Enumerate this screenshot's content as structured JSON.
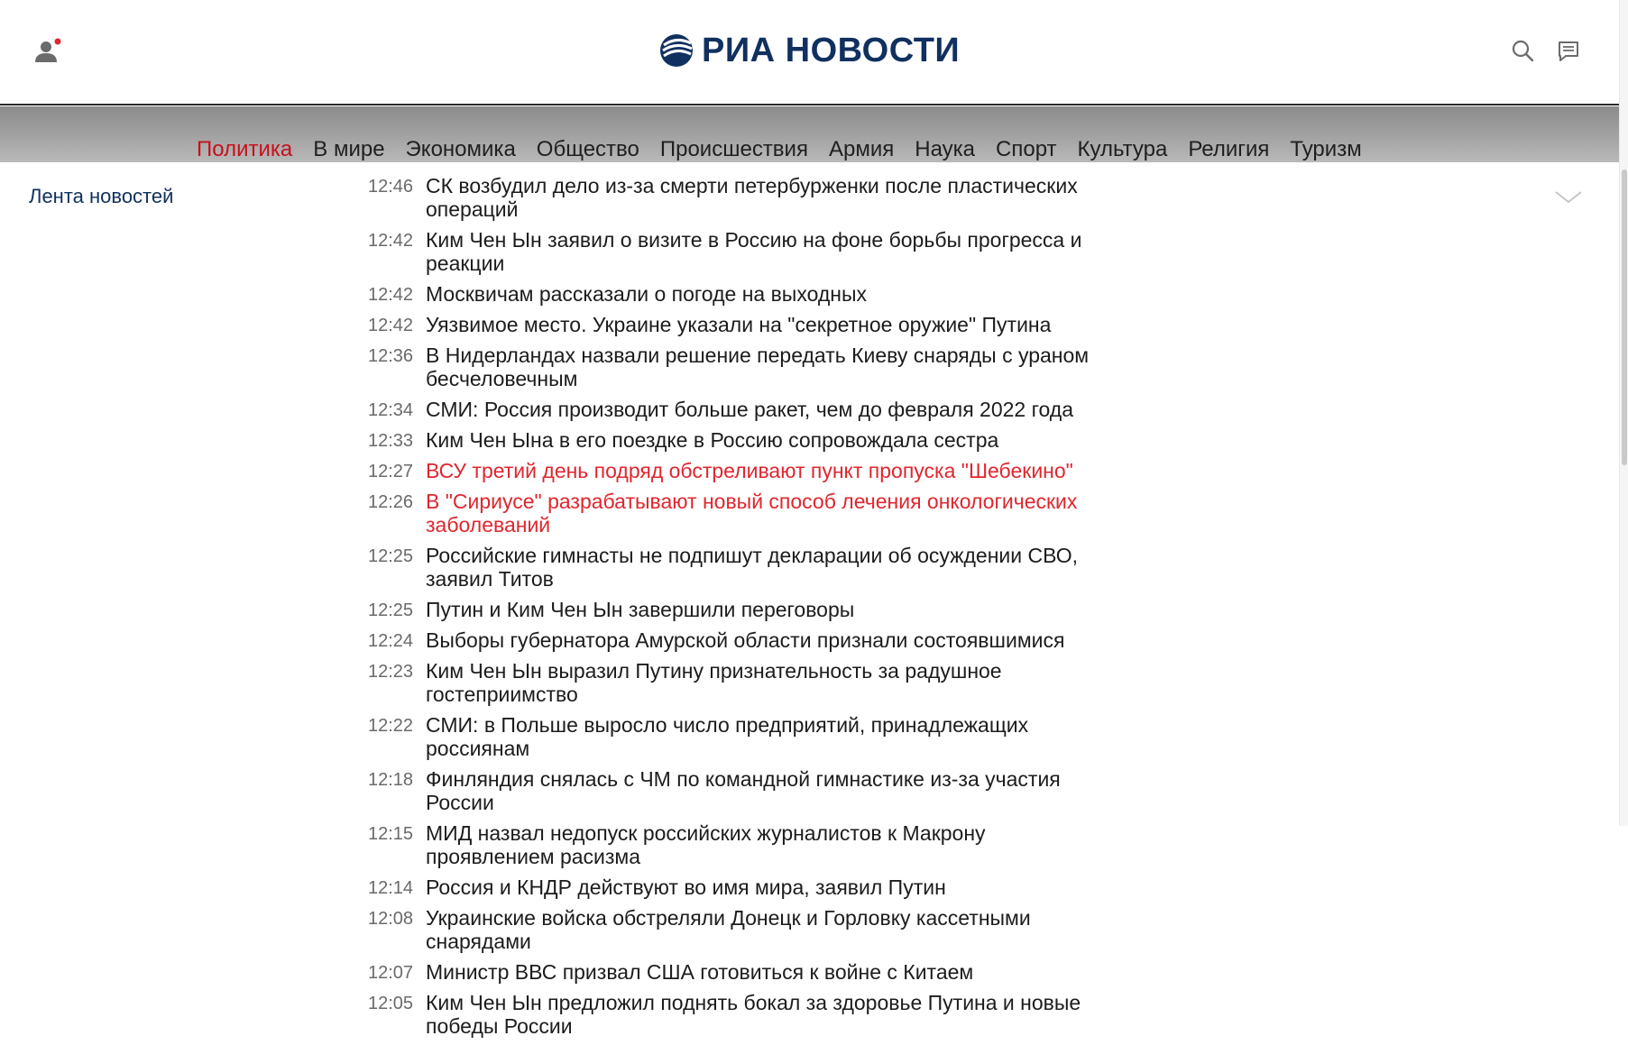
{
  "header": {
    "logo_text": "РИА НОВОСТИ",
    "icons": {
      "user": "user-icon",
      "search": "search-icon",
      "chat": "chat-icon"
    },
    "brand_color": "#10305f",
    "notification_dot_color": "#e0262e"
  },
  "nav": {
    "items": [
      {
        "label": "Политика",
        "active": true
      },
      {
        "label": "В мире",
        "active": false
      },
      {
        "label": "Экономика",
        "active": false
      },
      {
        "label": "Общество",
        "active": false
      },
      {
        "label": "Происшествия",
        "active": false
      },
      {
        "label": "Армия",
        "active": false
      },
      {
        "label": "Наука",
        "active": false
      },
      {
        "label": "Спорт",
        "active": false
      },
      {
        "label": "Культура",
        "active": false
      },
      {
        "label": "Религия",
        "active": false
      },
      {
        "label": "Туризм",
        "active": false
      }
    ],
    "active_color": "#c8101a"
  },
  "feed": {
    "title": "Лента новостей",
    "expand_icon": "chevron-down-icon",
    "highlight_color": "#e0262e",
    "items": [
      {
        "time": "12:46",
        "text": "СК возбудил дело из-за смерти петербурженки после пластических операций",
        "highlight": false
      },
      {
        "time": "12:42",
        "text": "Ким Чен Ын заявил о визите в Россию на фоне борьбы прогресса и реакции",
        "highlight": false
      },
      {
        "time": "12:42",
        "text": "Москвичам рассказали о погоде на выходных",
        "highlight": false
      },
      {
        "time": "12:42",
        "text": "Уязвимое место. Украине указали на \"секретное оружие\" Путина",
        "highlight": false
      },
      {
        "time": "12:36",
        "text": "В Нидерландах назвали решение передать Киеву снаряды с ураном бесчеловечным",
        "highlight": false
      },
      {
        "time": "12:34",
        "text": "СМИ: Россия производит больше ракет, чем до февраля 2022 года",
        "highlight": false
      },
      {
        "time": "12:33",
        "text": "Ким Чен Ына в его поездке в Россию сопровождала сестра",
        "highlight": false
      },
      {
        "time": "12:27",
        "text": "ВСУ третий день подряд обстреливают пункт пропуска \"Шебекино\"",
        "highlight": true
      },
      {
        "time": "12:26",
        "text": "В \"Сириусе\" разрабатывают новый способ лечения онкологических заболеваний",
        "highlight": true
      },
      {
        "time": "12:25",
        "text": "Российские гимнасты не подпишут декларации об осуждении СВО, заявил Титов",
        "highlight": false
      },
      {
        "time": "12:25",
        "text": "Путин и Ким Чен Ын завершили переговоры",
        "highlight": false
      },
      {
        "time": "12:24",
        "text": "Выборы губернатора Амурской области признали состоявшимися",
        "highlight": false
      },
      {
        "time": "12:23",
        "text": "Ким Чен Ын выразил Путину признательность за радушное гостеприимство",
        "highlight": false
      },
      {
        "time": "12:22",
        "text": "СМИ: в Польше выросло число предприятий, принадлежащих россиянам",
        "highlight": false
      },
      {
        "time": "12:18",
        "text": "Финляндия снялась с ЧМ по командной гимнастике из-за участия России",
        "highlight": false
      },
      {
        "time": "12:15",
        "text": "МИД назвал недопуск российских журналистов к Макрону проявлением расизма",
        "highlight": false
      },
      {
        "time": "12:14",
        "text": "Россия и КНДР действуют во имя мира, заявил Путин",
        "highlight": false
      },
      {
        "time": "12:08",
        "text": "Украинские войска обстреляли Донецк и Горловку кассетными снарядами",
        "highlight": false
      },
      {
        "time": "12:07",
        "text": "Министр ВВС призвал США готовиться к войне с Китаем",
        "highlight": false
      },
      {
        "time": "12:05",
        "text": "Ким Чен Ын предложил поднять бокал за здоровье Путина и новые победы России",
        "highlight": false
      }
    ]
  }
}
